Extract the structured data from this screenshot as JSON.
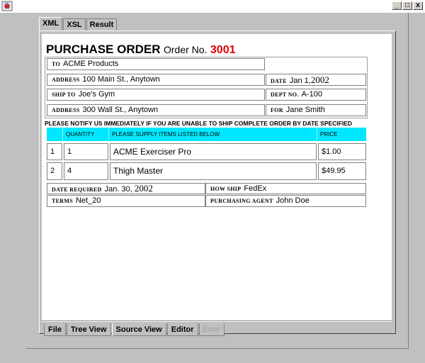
{
  "window": {
    "minimize": "_",
    "maximize": "□",
    "close": "x"
  },
  "top_tabs": [
    "XML",
    "XSL",
    "Result"
  ],
  "bottom_tabs": [
    "File",
    "Tree View",
    "Source View",
    "Editor",
    "Error"
  ],
  "po": {
    "title": "PURCHASE ORDER",
    "order_label": "Order No.",
    "order_no": "3001",
    "to_label": "TO",
    "to": "ACME Products",
    "address_label": "ADDRESS",
    "address": "100 Main St., Anytown",
    "date_label": "DATE",
    "date_text": "Jan 1,",
    "date_year": "2002",
    "ship_to_label": "SHIP TO",
    "ship_to": "Joe's Gym",
    "dept_label": "DEPT NO.",
    "dept": "A-100",
    "address2_label": "ADDRESS",
    "address2": "300 Wall St., Anytown",
    "for_label": "FOR",
    "for": "Jane Smith",
    "notice": "PLEASE NOTIFY US IMMEDIATELY IF YOU ARE UNABLE TO SHIP COMPLETE ORDER BY DATE SPECIFIED",
    "col_qty": "QUANTITY",
    "col_items": "PLEASE SUPPLY ITEMS LISTED BELOW",
    "col_price": "PRICE",
    "items": [
      {
        "num": "1",
        "qty": "1",
        "desc": "ACME Exerciser Pro",
        "price": "$1.00"
      },
      {
        "num": "2",
        "qty": "4",
        "desc": "Thigh Master",
        "price": "$49.95"
      }
    ],
    "date_req_label": "DATE REQUIRED",
    "date_req_text": "Jan. 30,",
    "date_req_year": "2002",
    "how_ship_label": "HOW SHIP",
    "how_ship": "FedEx",
    "terms_label": "TERMS",
    "terms": "Net_20",
    "agent_label": "PURCHASING AGENT",
    "agent": "John Doe"
  }
}
